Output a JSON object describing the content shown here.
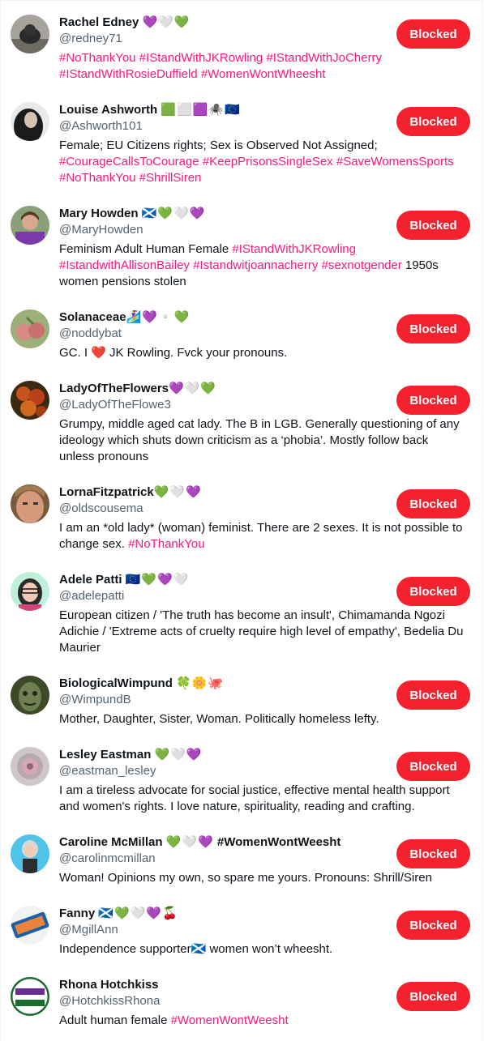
{
  "button_label": "Blocked",
  "colors": {
    "accent": "#f4212e",
    "hashtag": "#f91880",
    "muted": "#536471"
  },
  "users": [
    {
      "name": "Rachel Edney",
      "name_emoji": "💜🤍💚",
      "handle": "@redney71",
      "bio": [
        {
          "t": "#NoThankYou #IStandWithJKRowling #IStandWithJoCherry",
          "tag": true
        },
        {
          "t": "\n",
          "tag": false
        },
        {
          "t": "#IStandWithRosieDuffield #WomenWontWheesht",
          "tag": true
        }
      ],
      "avatar_icon": "dog-photo-avatar"
    },
    {
      "name": "Louise Ashworth",
      "name_emoji": "🟩⬜🟪🕷️🇪🇺",
      "handle": "@Ashworth101",
      "bio": [
        {
          "t": "Female; EU Citizens rights; Sex is Observed Not Assigned;",
          "tag": false
        },
        {
          "t": "\n",
          "tag": false
        },
        {
          "t": "#CourageCallsToCourage #KeepPrisonsSingleSex #SaveWomensSports",
          "tag": true
        },
        {
          "t": "\n",
          "tag": false
        },
        {
          "t": "#NoThankYou #ShrillSiren",
          "tag": true
        }
      ],
      "avatar_icon": "woman-photo-avatar"
    },
    {
      "name": "Mary Howden",
      "name_emoji": "🏴󠁧󠁢󠁳󠁣󠁴󠁿💚🤍💜",
      "handle": "@MaryHowden",
      "bio": [
        {
          "t": "Feminism Adult Human Female ",
          "tag": false
        },
        {
          "t": "#IStandWithJKRowling",
          "tag": true
        },
        {
          "t": "\n",
          "tag": false
        },
        {
          "t": "#IstandwithAllisonBailey #Istandwitjoannacherry #sexnotgender",
          "tag": true
        },
        {
          "t": " 1950s",
          "tag": false
        },
        {
          "t": "\n",
          "tag": false
        },
        {
          "t": "women pensions stolen",
          "tag": false
        }
      ],
      "avatar_icon": "woman-purple-shirt-avatar"
    },
    {
      "name": "Solanaceae",
      "name_emoji": "🏄‍♀️💜▫️💚",
      "handle": "@noddybat",
      "bio": [
        {
          "t": "GC. I ❤️ JK Rowling. Fvck your pronouns.",
          "tag": false
        }
      ],
      "avatar_icon": "fruit-photo-avatar"
    },
    {
      "name": "LadyOfTheFlowers",
      "name_emoji": "💜🤍💚",
      "handle": "@LadyOfTheFlowe3",
      "bio": [
        {
          "t": "Grumpy, middle aged cat lady. The B in LGB. Generally questioning of any",
          "tag": false
        },
        {
          "t": "\n",
          "tag": false
        },
        {
          "t": "ideology which shuts down criticism as a ‘phobia’. Mostly follow back",
          "tag": false
        },
        {
          "t": "\n",
          "tag": false
        },
        {
          "t": "unless pronouns",
          "tag": false
        }
      ],
      "avatar_icon": "flowers-photo-avatar"
    },
    {
      "name": "LornaFitzpatrick",
      "name_emoji": "💚🤍💜",
      "handle": "@oldscousema",
      "bio": [
        {
          "t": "I am an *old lady* (woman) feminist. There are 2 sexes. It is not possible to",
          "tag": false
        },
        {
          "t": "\n",
          "tag": false
        },
        {
          "t": "change sex. ",
          "tag": false
        },
        {
          "t": "#NoThankYou",
          "tag": true
        }
      ],
      "avatar_icon": "face-photo-avatar"
    },
    {
      "name": "Adele Patti",
      "name_emoji": "🇪🇺💚💜🤍",
      "handle": "@adelepatti",
      "bio": [
        {
          "t": "European citizen / 'The truth has become an insult', Chimamanda Ngozi",
          "tag": false
        },
        {
          "t": "\n",
          "tag": false
        },
        {
          "t": "Adichie / 'Extreme acts of cruelty require high level of empathy', Bedelia Du",
          "tag": false
        },
        {
          "t": "\n",
          "tag": false
        },
        {
          "t": "Maurier",
          "tag": false
        }
      ],
      "avatar_icon": "cartoon-woman-avatar"
    },
    {
      "name": "BiologicalWimpund",
      "name_emoji": "🍀🌼🐙",
      "handle": "@WimpundB",
      "bio": [
        {
          "t": "Mother, Daughter, Sister, Woman. Politically homeless lefty.",
          "tag": false
        }
      ],
      "avatar_icon": "green-man-avatar"
    },
    {
      "name": "Lesley Eastman",
      "name_emoji": "💚🤍💜",
      "handle": "@eastman_lesley",
      "bio": [
        {
          "t": "I am a tireless advocate for social justice, effective mental health support",
          "tag": false
        },
        {
          "t": "\n",
          "tag": false
        },
        {
          "t": "and women's rights. I love nature, spirituality, reading and crafting.",
          "tag": false
        }
      ],
      "avatar_icon": "mandala-avatar"
    },
    {
      "name": "Caroline McMillan",
      "name_emoji": "💚🤍💜",
      "name_suffix": " #WomenWontWeesht",
      "handle": "@carolinmcmillan",
      "bio": [
        {
          "t": "Woman! Opinions my own, so spare me yours. Pronouns: Shrill/Siren",
          "tag": false
        }
      ],
      "avatar_icon": "cartoon-grey-hair-avatar"
    },
    {
      "name": "Fanny",
      "name_emoji": "🏴󠁧󠁢󠁳󠁣󠁴󠁿💚🤍💜🍒",
      "handle": "@MgillAnn",
      "bio": [
        {
          "t": "Independence supporter🏴󠁧󠁢󠁳󠁣󠁴󠁿 women won’t wheesht.",
          "tag": false
        }
      ],
      "avatar_icon": "fanny-logo-avatar"
    },
    {
      "name": "Rhona Hotchkiss",
      "name_emoji": "",
      "handle": "@HotchkissRhona",
      "bio": [
        {
          "t": "Adult human female ",
          "tag": false
        },
        {
          "t": "#WomenWontWeesht",
          "tag": true
        }
      ],
      "avatar_icon": "suffragette-badge-avatar"
    }
  ]
}
